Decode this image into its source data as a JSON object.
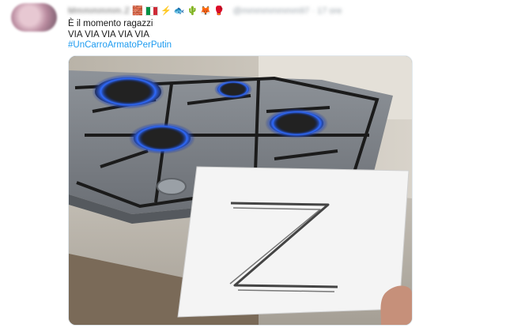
{
  "author": {
    "name_blurred": "Mmmmmmm.Z",
    "handle_blurred": "@mmmmmmmm97 · 17 ore",
    "badges": [
      "brick",
      "flag-italy",
      "lightning",
      "fish",
      "cactus",
      "fox",
      "boxing-glove"
    ]
  },
  "tweet": {
    "line1": "È il momento ragazzi",
    "line2": "VIA VIA VIA VIA VIA",
    "hashtag": "#UnCarroArmatoPerPutin"
  },
  "media": {
    "description_letter": "Z"
  },
  "colors": {
    "hashtag": "#1d9bf0",
    "flame": "#2f6bff"
  }
}
